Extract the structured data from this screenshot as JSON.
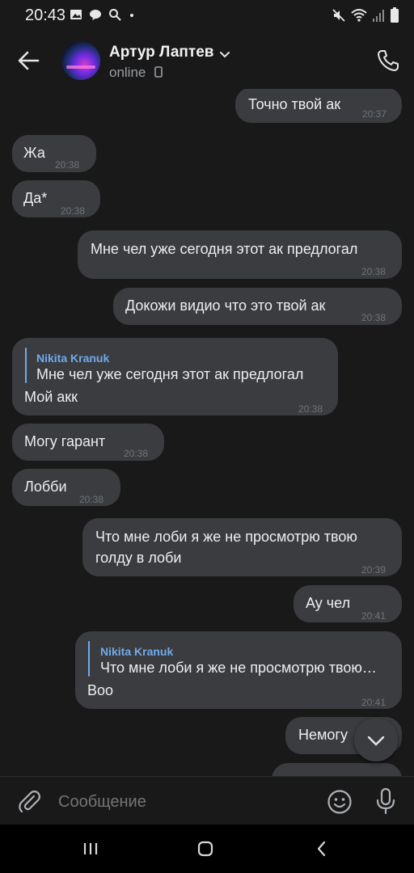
{
  "status_bar": {
    "time": "20:43"
  },
  "header": {
    "contact_name": "Артур Лаптев",
    "status": "online"
  },
  "messages": [
    {
      "dir": "out",
      "text": "Точно твой ак",
      "time": "20:37"
    },
    {
      "dir": "in",
      "text": "Жа",
      "time": "20:38"
    },
    {
      "dir": "in",
      "text": "Да*",
      "time": "20:38"
    },
    {
      "dir": "out",
      "text": "Мне чел уже сегодня этот ак предлогал",
      "time": "20:38"
    },
    {
      "dir": "out",
      "text": "Докожи видио что это твой ак",
      "time": "20:38"
    },
    {
      "dir": "in",
      "reply_author": "Nikita Kranuk",
      "reply_text": "Мне чел уже сегодня этот ак предлогал",
      "text": "Мой акк",
      "time": "20:38"
    },
    {
      "dir": "in",
      "text": "Могу гарант",
      "time": "20:38"
    },
    {
      "dir": "in",
      "text": "Лобби",
      "time": "20:38"
    },
    {
      "dir": "out",
      "text_line1": "Что мне лоби я же не просмотрю твою",
      "text_line2": "голду в лоби",
      "time": "20:39"
    },
    {
      "dir": "out",
      "text": "Ау чел",
      "time": "20:41"
    },
    {
      "dir": "out",
      "reply_author": "Nikita Kranuk",
      "reply_text": "Что мне лоби я же не просмотрю твою…",
      "text": "Воо",
      "time": "20:41"
    },
    {
      "dir": "out",
      "text": "Немогу",
      "time": ""
    }
  ],
  "composer": {
    "placeholder": "Сообщение"
  },
  "icons": {
    "back": "arrow-left-icon",
    "phone": "phone-icon",
    "attach": "paperclip-icon",
    "emoji": "smile-icon",
    "mic": "microphone-icon",
    "scroll_down": "chevron-down-icon"
  },
  "colors": {
    "background": "#19191a",
    "bubble": "#3b3c3f",
    "reply_accent": "#71aaeb",
    "time_text": "#6f7378"
  }
}
